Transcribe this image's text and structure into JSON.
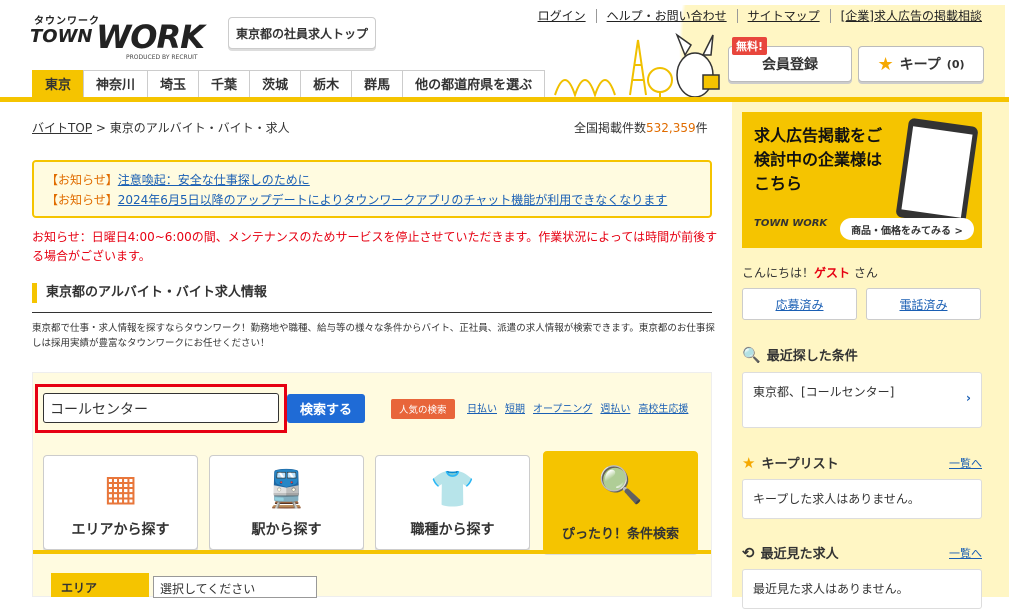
{
  "header": {
    "logo_kana": "タウンワーク",
    "logo_town": "TOWN",
    "logo_work": "WORK",
    "logo_produced": "PRODUCED BY RECRUIT",
    "top_link": "東京都の社員求人トップ",
    "util_links": [
      "ログイン",
      "ヘルプ・お問い合わせ",
      "サイトマップ",
      "[企業]求人広告の掲載相談"
    ],
    "register_label": "会員登録",
    "free_badge": "無料!",
    "keep_label": "キープ",
    "keep_count": "(0)",
    "tabs": [
      "東京",
      "神奈川",
      "埼玉",
      "千葉",
      "茨城",
      "栃木",
      "群馬",
      "他の都道府県を選ぶ"
    ]
  },
  "main": {
    "breadcrumb_home": "バイトTOP",
    "breadcrumb_sep": ">",
    "breadcrumb_current": "東京のアルバイト・バイト・求人",
    "count_label": "全国掲載件数",
    "count_value": "532,359",
    "count_unit": "件",
    "notices": [
      {
        "tag": "【お知らせ】",
        "text": "注意喚起：安全な仕事探しのために"
      },
      {
        "tag": "【お知らせ】",
        "text": "2024年6月5日以降のアップデートによりタウンワークアプリのチャット機能が利用できなくなります"
      }
    ],
    "maintenance": "お知らせ：日曜日4:00~6:00の間、メンテナンスのためサービスを停止させていただきます。作業状況によっては時間が前後する場合がございます。",
    "section_title": "東京都のアルバイト・バイト求人情報",
    "description": "東京都で仕事・求人情報を探すならタウンワーク！勤務地や職種、給与等の様々な条件からバイト、正社員、派遣の求人情報が検索できます。東京都のお仕事探しは採用実績が豊富なタウンワークにお任せください！",
    "search": {
      "value": "コールセンター",
      "button": "検索する",
      "popular_label": "人気の検索",
      "popular_links": [
        "日払い",
        "短期",
        "オープニング",
        "週払い",
        "高校生応援"
      ]
    },
    "categories": [
      {
        "label": "エリアから探す",
        "icon": "area-map-icon"
      },
      {
        "label": "駅から探す",
        "icon": "train-icon"
      },
      {
        "label": "職種から探す",
        "icon": "job-type-icon"
      },
      {
        "label": "ぴったり！条件検索",
        "icon": "magnifier-heart-icon"
      }
    ],
    "area_label": "エリア",
    "area_select": "選択してください"
  },
  "sidebar": {
    "ad_text": "求人広告掲載をご検討中の企業様はこちら",
    "ad_logo": "TOWN WORK",
    "ad_button": "商品・価格をみてみる >",
    "greeting_pre": "こんにちは！",
    "greeting_name": "ゲスト",
    "greeting_post": "さん",
    "applied": "応募済み",
    "called": "電話済み",
    "recent_search_title": "最近探した条件",
    "recent_search_value": "東京都、[コールセンター]",
    "keep_list_title": "キープリスト",
    "keep_list_link": "一覧へ",
    "keep_list_empty": "キープした求人はありません。",
    "recent_view_title": "最近見た求人",
    "recent_view_link": "一覧へ",
    "recent_view_empty": "最近見た求人はありません。"
  },
  "colors": {
    "brand_yellow": "#f5c400",
    "link_blue": "#1a5fb4",
    "alert_red": "#e60012",
    "search_blue": "#1f6bd6"
  }
}
